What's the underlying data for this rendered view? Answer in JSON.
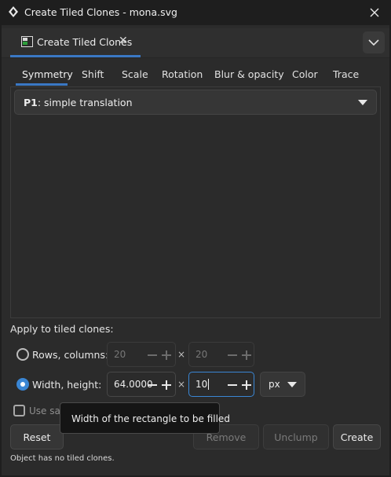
{
  "window": {
    "title": "Create Tiled Clones - mona.svg",
    "app_icon": "inkscape-logo-icon",
    "close_icon": "close-icon"
  },
  "dock": {
    "tab_label": "Create Tiled Clones",
    "tab_icon": "tiled-clones-icon",
    "tab_close_icon": "close-icon",
    "menu_icon": "chevron-down-icon",
    "accent_color": "#3a78c4"
  },
  "tabs": [
    {
      "label": "Symmetry",
      "active": true
    },
    {
      "label": "Shift"
    },
    {
      "label": "Scale"
    },
    {
      "label": "Rotation"
    },
    {
      "label": "Blur & opacity"
    },
    {
      "label": "Color"
    },
    {
      "label": "Trace"
    }
  ],
  "symmetry": {
    "selected_code": "P1",
    "selected_name": ": simple translation"
  },
  "apply": {
    "heading": "Apply to tiled clones:",
    "rows_columns": {
      "label": "Rows, columns:",
      "rows": "20",
      "columns": "20",
      "selected": false
    },
    "width_height": {
      "label": "Width, height:",
      "width": "64.0000",
      "height": "10",
      "unit": "px",
      "selected": true
    },
    "times_symbol": "×",
    "use_saved": {
      "label": "Use saved size and position of the tile",
      "checked": false
    }
  },
  "buttons": {
    "reset": "Reset",
    "remove": "Remove",
    "unclump": "Unclump",
    "create": "Create"
  },
  "status": "Object has no tiled clones.",
  "tooltip": "Width of the rectangle to be filled"
}
